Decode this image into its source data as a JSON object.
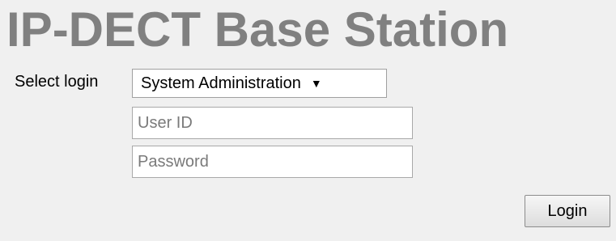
{
  "page": {
    "title": "IP-DECT Base Station"
  },
  "login_form": {
    "select_label": "Select login",
    "select_value": "System Administration",
    "select_arrow": "▼",
    "userid_placeholder": "User ID",
    "userid_value": "",
    "password_placeholder": "Password",
    "password_value": "",
    "login_button_label": "Login"
  },
  "icons": {
    "dropdown": "triangle-down-icon"
  },
  "colors": {
    "background": "#f0f0f0",
    "title": "#808080",
    "input_background": "#ffffff",
    "placeholder": "#7a7a7a"
  }
}
